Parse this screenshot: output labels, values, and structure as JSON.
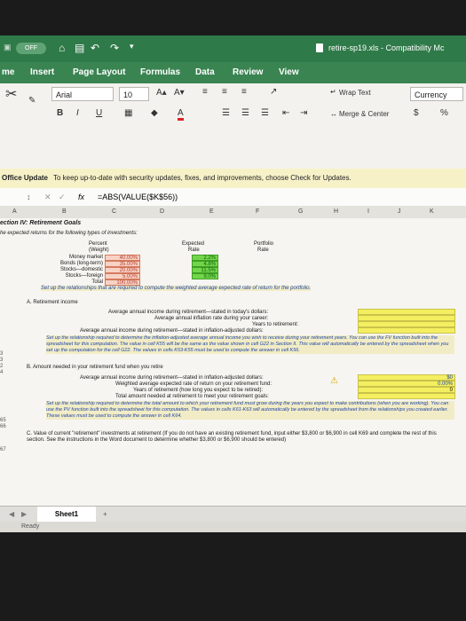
{
  "titlebar": {
    "autosave": "OFF",
    "filename": "retire-sp19.xls - Compatibility Mc"
  },
  "tabs": [
    "me",
    "Insert",
    "Page Layout",
    "Formulas",
    "Data",
    "Review",
    "View"
  ],
  "ribbon": {
    "font_name": "Arial",
    "font_size": "10",
    "grow_font": "A▴",
    "shrink_font": "A▾",
    "bold": "B",
    "italic": "I",
    "underline": "U",
    "wrap_text": "Wrap Text",
    "merge_center": "Merge & Center",
    "number_format": "Currency",
    "currency_symbol": "$",
    "percent_symbol": "%"
  },
  "message_bar": {
    "title": "Office Update",
    "text": "To keep up-to-date with security updates, fixes, and improvements, choose Check for Updates."
  },
  "formula_bar": {
    "fx": "fx",
    "formula": "=ABS(VALUE($K$56))"
  },
  "columns": [
    "A",
    "B",
    "C",
    "D",
    "E",
    "F",
    "G",
    "H",
    "I",
    "J",
    "K"
  ],
  "section": {
    "title": "ection IV: Retirement Goals",
    "intro": "he expected returns for the following types of investments:",
    "headers": {
      "percent1": "Percent",
      "percent2": "(Weight)",
      "expected1": "Expected",
      "expected2": "Rate",
      "portfolio1": "Portfolio",
      "portfolio2": "Rate"
    },
    "investments": [
      {
        "name": "Money market",
        "weight": "40.00%",
        "rate": "2.2%"
      },
      {
        "name": "Bonds (long-term)",
        "weight": "35.00%",
        "rate": "4.8%"
      },
      {
        "name": "Stocks—domestic",
        "weight": "20.00%",
        "rate": "11.5%"
      },
      {
        "name": "Stocks—foreign",
        "weight": "5.00%",
        "rate": "9.0%"
      }
    ],
    "total_label": "Total",
    "total_value": "100.00%",
    "setup_note": "Set up the relationships that are required to compute the weighted average expected rate of return for the portfolio."
  },
  "partA": {
    "title": "A. Retirement income",
    "line1": "Average annual income during retirement—stated in today's dollars:",
    "line2": "Average annual inflation rate during your career:",
    "line3": "Years to retirement:",
    "line4": "Average annual income during retirement—stated in inflation-adjusted dollars:",
    "note": "Set up the relationship required to determine the inflation-adjusted average annual income you wish to receive during your retirement years. You can use the FV function built into the spreadsheet for this computation. The value in cell K55 will be the same as the value shown in cell G22 in Section II. This value will automatically be entered by the spreadsheet when you set up the computation for the cell G22. The values in cells K53-K55 must be used to compute the answer in cell K56."
  },
  "partB": {
    "title": "B. Amount needed in your retirement fund when you retire",
    "line1": "Average annual income during retirement—stated in inflation-adjusted dollars:",
    "line2": "Weighted average expected rate of return on your retirement fund:",
    "line3": "Years of retirement (how long you expect to be retired):",
    "line4": "Total amount needed at retirement to meet your retirement goals:",
    "val1": "$0",
    "val2": "0.00%",
    "val3": "0",
    "note": "Set up the relationship required to determine the total amount to which your retirement fund must grow during the years you expect to make contributions (when you are working). You can use the PV function built into the spreadsheet for this computation. The values in cells K61-K63 will automatically be entered by the spreadsheet from the relationships you created earlier. These values must be used to compute the answer in cell K64."
  },
  "partC": {
    "text": "C. Value of current \"retirement\" investments at retirement (If you do not have an existing retirement fund, input either $3,800 or $6,900 in cell K69 and complete the rest of this section. See the instructions in the Word document to determine whether $3,800 or $6,900 should be entered)"
  },
  "row_numbers": {
    "r1": "3",
    "r2": "3",
    "r3": "2",
    "r4": "4",
    "r65": "65",
    "r66": "66",
    "r67": "67"
  },
  "sheet_tab": "Sheet1",
  "status": "Ready",
  "colors": {
    "ribbon_green": "#2f7a49",
    "input_yellow": "#f4ef60",
    "weight_pink": "#f7d3c6",
    "rate_green": "#73d64a",
    "note_blue": "#1e46a8"
  }
}
